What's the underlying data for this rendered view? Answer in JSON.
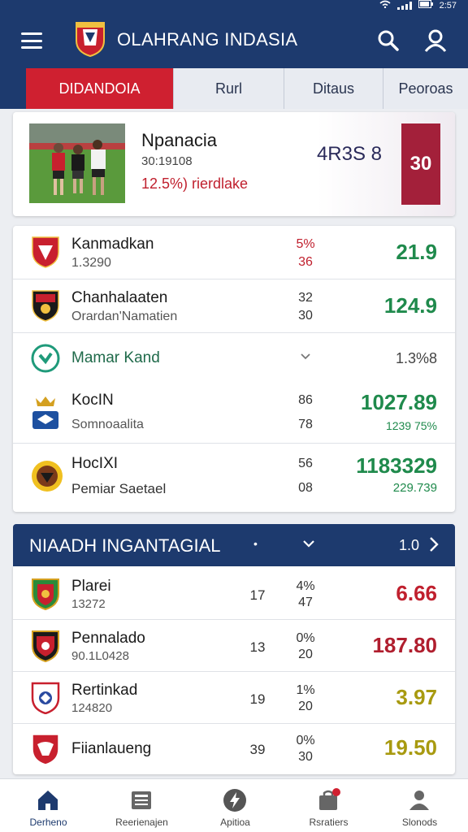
{
  "statusbar": {
    "time": "2:57"
  },
  "app": {
    "title": "OLAHRANG INDASIA"
  },
  "tabs": [
    {
      "label": "DIDANDOIA",
      "active": true
    },
    {
      "label": "Rurl",
      "active": false
    },
    {
      "label": "Ditaus",
      "active": false
    },
    {
      "label": "Peoroas",
      "active": false
    }
  ],
  "hero": {
    "title": "Npanacia",
    "subtitle": "30:19108",
    "note": "12.5%) rierdlake",
    "score": "4R3S 8",
    "score_box": "30"
  },
  "group1": {
    "rows": [
      {
        "name": "Kanmadkan",
        "sub": "1.3290",
        "s1": "5%",
        "s2": "36",
        "value": "21.9",
        "value_color": "#1f8a4c",
        "s_color": "#c0202e"
      },
      {
        "name": "Chanhalaaten",
        "sub": "Orardan'Namatien",
        "s1": "32",
        "s2": "30",
        "value": "124.9",
        "value_color": "#1f8a4c",
        "s_color": "#333333"
      },
      {
        "name": "Mamar Kand",
        "pct": "1.3%8"
      },
      {
        "name": "KocIN",
        "sub": "Somnoaalita",
        "s1": "86",
        "s2": "78",
        "value": "1027.89",
        "value2": "1239 75%",
        "value_color": "#1f8a4c"
      },
      {
        "name": "HocIXI",
        "sub": "Pemiar Saetael",
        "s1": "56",
        "s2": "08",
        "value": "1183329",
        "value2": "229.739",
        "value_color": "#1f8a4c"
      }
    ]
  },
  "section": {
    "title": "NIAADH INGANTAGIAL",
    "dot": "•",
    "value": "1.0"
  },
  "group2": {
    "rows": [
      {
        "name": "Plarei",
        "sub": "13272",
        "c1": "17",
        "s1": "4%",
        "s2": "47",
        "value": "6.66",
        "value_color": "#c0202e"
      },
      {
        "name": "Pennalado",
        "sub": "90.1L0428",
        "c1": "13",
        "s1": "0%",
        "s2": "20",
        "value": "187.80",
        "value_color": "#b01e2e"
      },
      {
        "name": "Rertinkad",
        "sub": "124820",
        "c1": "19",
        "s1": "1%",
        "s2": "20",
        "value": "3.97",
        "value_color": "#a89a10"
      },
      {
        "name": "Fiianlaueng",
        "sub": "",
        "c1": "39",
        "s1": "0%",
        "s2": "30",
        "value": "19.50",
        "value_color": "#a89a10"
      }
    ]
  },
  "bottom_nav": [
    {
      "label": "Derheno",
      "icon": "home-icon",
      "active": true
    },
    {
      "label": "Reerienajen",
      "icon": "news-icon",
      "active": false
    },
    {
      "label": "Apitioa",
      "icon": "lightning-icon",
      "active": false
    },
    {
      "label": "Rsratiers",
      "icon": "bag-icon",
      "active": false
    },
    {
      "label": "Slonods",
      "icon": "profile-icon",
      "active": false
    }
  ],
  "colors": {
    "primary": "#1d3a6e",
    "accent_red": "#cf2030",
    "positive": "#1f8a4c"
  }
}
